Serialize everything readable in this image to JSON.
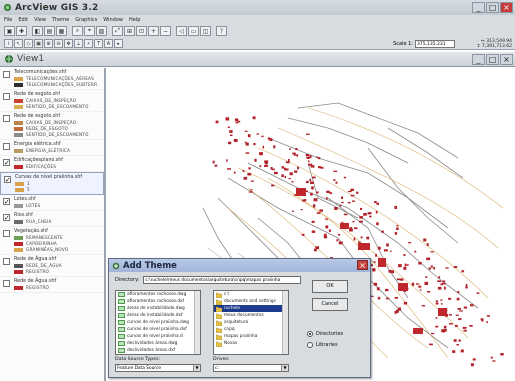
{
  "app": {
    "title": "ArcView GIS 3.2"
  },
  "menu": [
    "File",
    "Edit",
    "View",
    "Theme",
    "Graphics",
    "Window",
    "Help"
  ],
  "scale": {
    "label": "Scale 1:",
    "value": "375,135.231"
  },
  "coords": {
    "x": "↔ 313,549.94",
    "y": "↕ 7,391,713.62"
  },
  "view": {
    "title": "View1"
  },
  "toc": [
    {
      "name": "Telecomunicações.shf",
      "checked": false,
      "legend": [
        {
          "label": "TELECOMUNICAÇÕES_AÉREAS",
          "color": "#d9a24a"
        },
        {
          "label": "TELECOMUNICAÇÕES_SUBTERR",
          "color": "#2f2f2f"
        }
      ]
    },
    {
      "name": "Rede de esgoto.shf",
      "checked": false,
      "legend": [
        {
          "label": "CAIXAS_DE_INSPEÇÃO",
          "color": "#c8402e"
        },
        {
          "label": "SENTIDO_DE_ESCOAMENTO",
          "color": "#d6b050"
        }
      ]
    },
    {
      "name": "Rede de esgoto.shf",
      "checked": false,
      "legend": [
        {
          "label": "CAIXAS_DE_INSPEÇÃO",
          "color": "#b8864a"
        },
        {
          "label": "REDE_DE_ESGOTO",
          "color": "#c26b3a"
        },
        {
          "label": "SENTIDO_DE_ESCOAMENTO",
          "color": "#8a8a8a"
        }
      ]
    },
    {
      "name": "Energia elétrica.shf",
      "checked": false,
      "legend": [
        {
          "label": "ENERGIA_ELÉTRICA",
          "color": "#b79a62"
        }
      ]
    },
    {
      "name": "Edificaçõesplano.shf",
      "checked": true,
      "legend": [
        {
          "label": "EDIFICAÇÕES",
          "color": "#c0272d"
        }
      ]
    },
    {
      "name": "Curvas de nível praiinha.shf",
      "checked": true,
      "selected": true,
      "legend": [
        {
          "label": "1",
          "color": "#d9a24a"
        },
        {
          "label": "5",
          "color": "#d9a24a"
        }
      ]
    },
    {
      "name": "Lotes.shf",
      "checked": true,
      "legend": [
        {
          "label": "LOTES",
          "color": "#9a9a9a"
        }
      ]
    },
    {
      "name": "Rios.shf",
      "checked": true,
      "legend": [
        {
          "label": "RUA_CHEIA",
          "color": "#6b6b6b"
        }
      ]
    },
    {
      "name": "Vegetação.shf",
      "checked": false,
      "legend": [
        {
          "label": "REMANESCENTE",
          "color": "#6fa05a"
        },
        {
          "label": "CAPOEIRINHA",
          "color": "#c0272d"
        },
        {
          "label": "GRAMINÉAS_NOVO",
          "color": "#d9a24a"
        }
      ]
    },
    {
      "name": "Rede de Água.shf",
      "checked": false,
      "legend": [
        {
          "label": "REDE_DE_ÁGUA",
          "color": "#555555"
        },
        {
          "label": "REGISTRO",
          "color": "#c0272d"
        }
      ]
    },
    {
      "name": "Rede de Água.shf",
      "checked": false,
      "legend": [
        {
          "label": "REGISTRO",
          "color": "#c0272d"
        }
      ]
    }
  ],
  "dialog": {
    "title": "Add Theme",
    "directory_label": "Directory:",
    "directory_value": "c:\\ruchele\\meus documentos\\arquitetura\\cnpq\\mapas praiinha",
    "files": [
      "afloramentos rochosos.dwg",
      "afloramentos rochosos.dxf",
      "áreas de instabilidade.dwg",
      "áreas de instabilidade.dxf",
      "curvas de nível praiinha.dwg",
      "curvas de nível praiinha.dxf",
      "curvas de nível praiinha.d",
      "declividades áreas.dwg",
      "declividades áreas.dxf"
    ],
    "folders": [
      "c:\\",
      "documents and settings",
      "ruchele",
      "meus documentos",
      "arquitetura",
      "cnpq",
      "mapas praiinha",
      "Novas"
    ],
    "selected_folder_index": 2,
    "ok_label": "OK",
    "cancel_label": "Cancel",
    "radio_directories": "Directories",
    "radio_libraries": "Libraries",
    "source_types_label": "Data Source Types:",
    "source_types_value": "Feature Data Source",
    "drives_label": "Drives:",
    "drives_value": "c:"
  }
}
